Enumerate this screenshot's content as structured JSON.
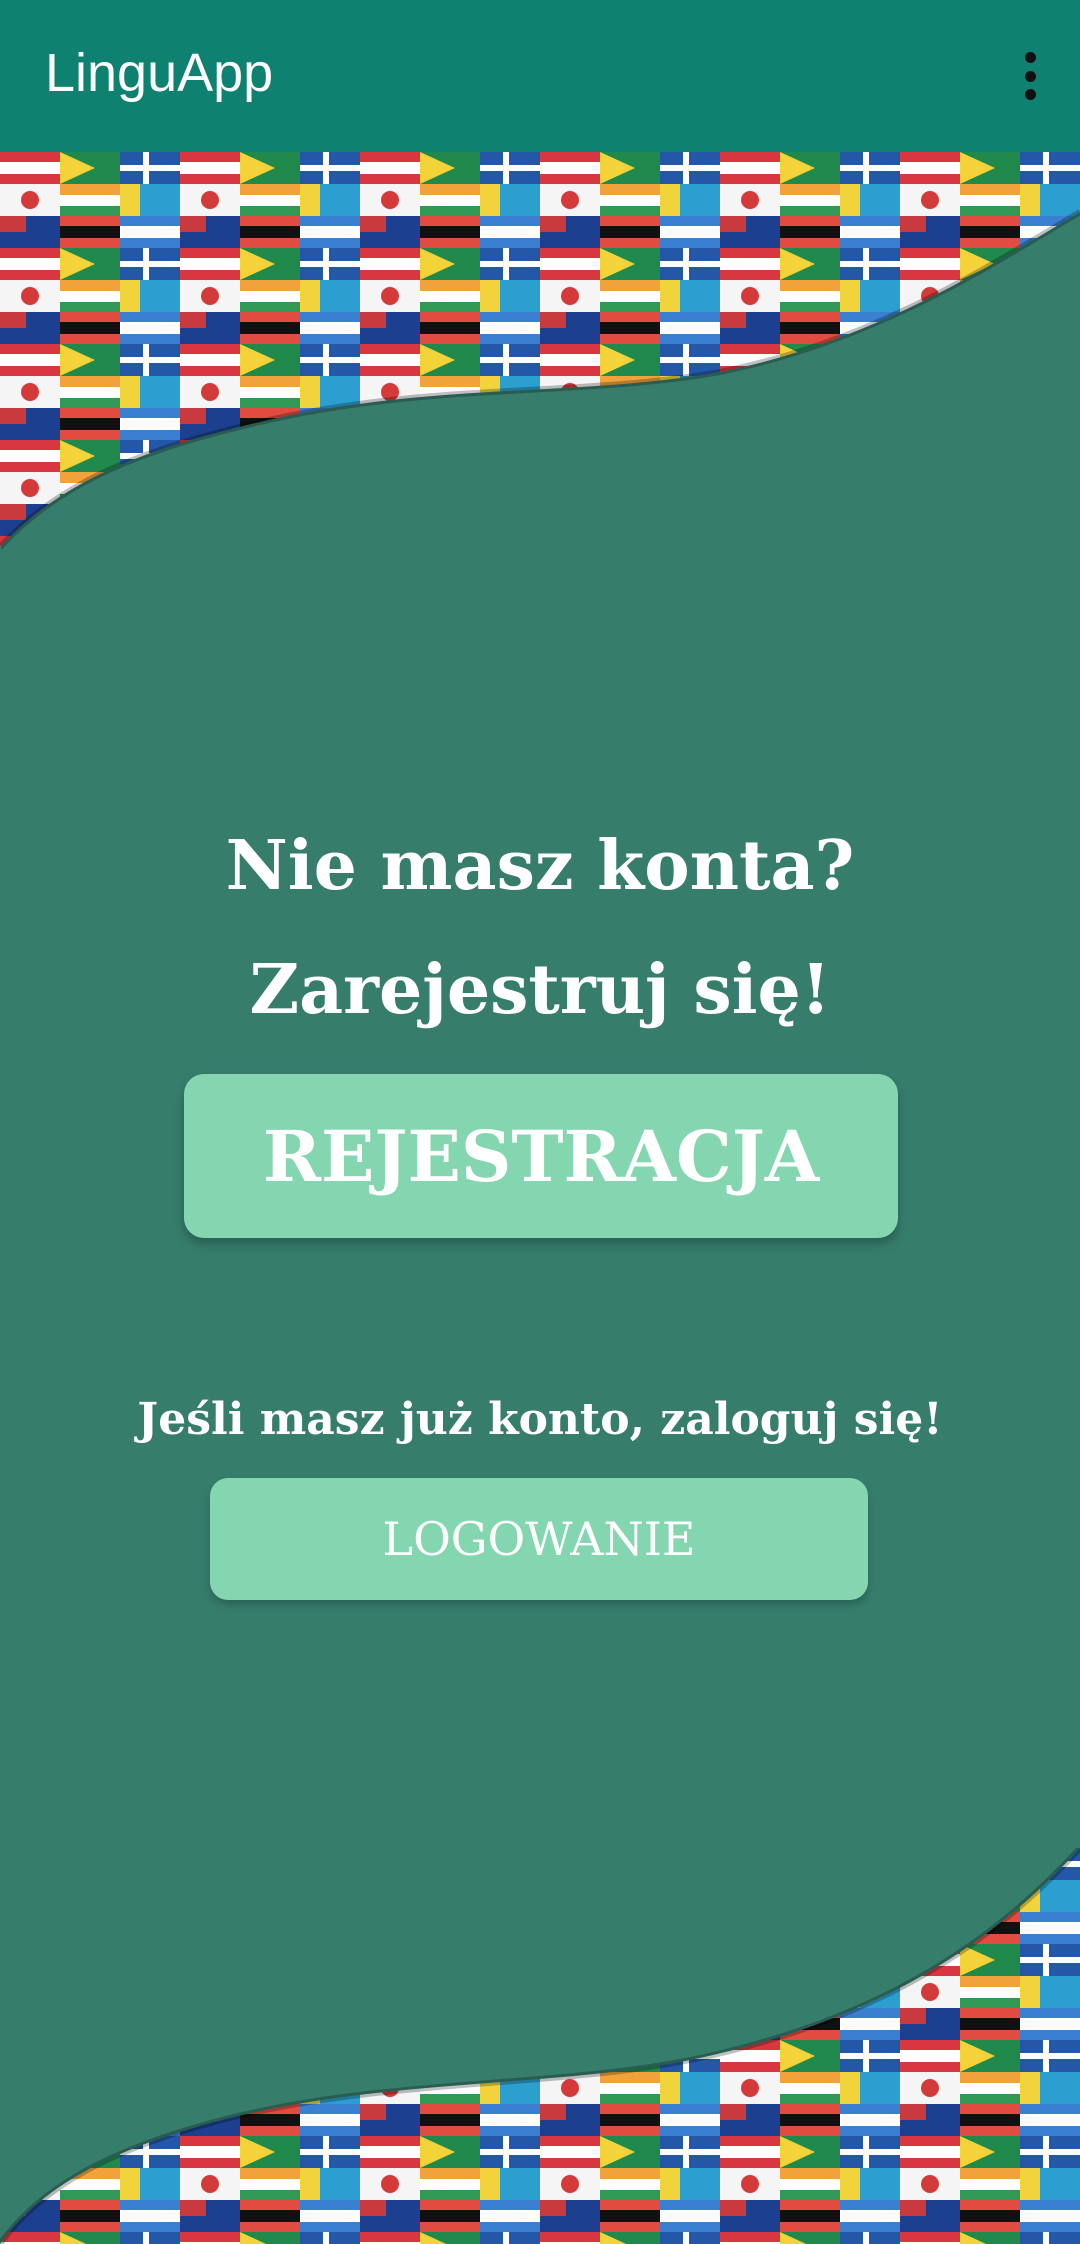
{
  "app_bar": {
    "title": "LinguApp"
  },
  "main": {
    "heading_line1": "Nie masz konta?",
    "heading_line2": "Zarejestruj się!",
    "register_label": "REJESTRACJA",
    "login_hint": "Jeśli masz już konto, zaloguj się!",
    "login_label": "LOGOWANIE"
  },
  "colors": {
    "app_bar": "#0e8170",
    "background": "#377d6c",
    "button": "#84d6b0"
  },
  "icons": {
    "menu": "more-vert-icon"
  }
}
